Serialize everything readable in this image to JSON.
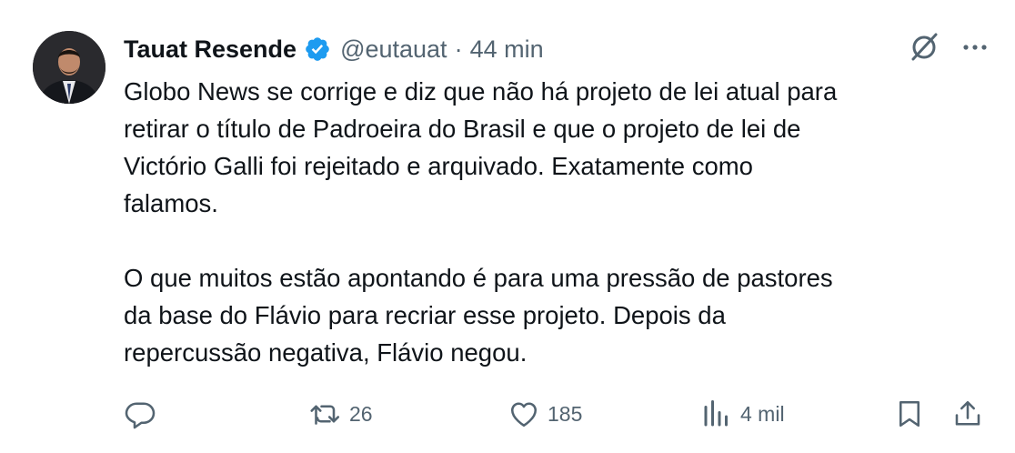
{
  "tweet": {
    "author_name": "Tauat Resende",
    "handle": "@eutauat",
    "separator": "·",
    "time": "44 min",
    "text": "Globo News se corrige e diz que não há projeto de lei atual para\nretirar o título de Padroeira do Brasil e que o projeto de lei de\nVictório Galli foi rejeitado e arquivado. Exatamente como\nfalamos.\n\nO que muitos estão apontando é para uma pressão de pastores\nda base do Flávio para recriar esse projeto. Depois da\nrepercussão negativa, Flávio negou."
  },
  "actions": {
    "reply_count": "",
    "retweet_count": "26",
    "like_count": "185",
    "views_count": "4 mil"
  },
  "icons": {
    "verified": "verified-badge-icon",
    "grok": "grok-icon",
    "more": "more-icon",
    "reply": "reply-icon",
    "retweet": "retweet-icon",
    "like": "heart-icon",
    "views": "views-icon",
    "bookmark": "bookmark-icon",
    "share": "share-icon"
  },
  "colors": {
    "verified_blue": "#1d9bf0",
    "secondary_text": "#536471",
    "primary_text": "#0f1419"
  }
}
